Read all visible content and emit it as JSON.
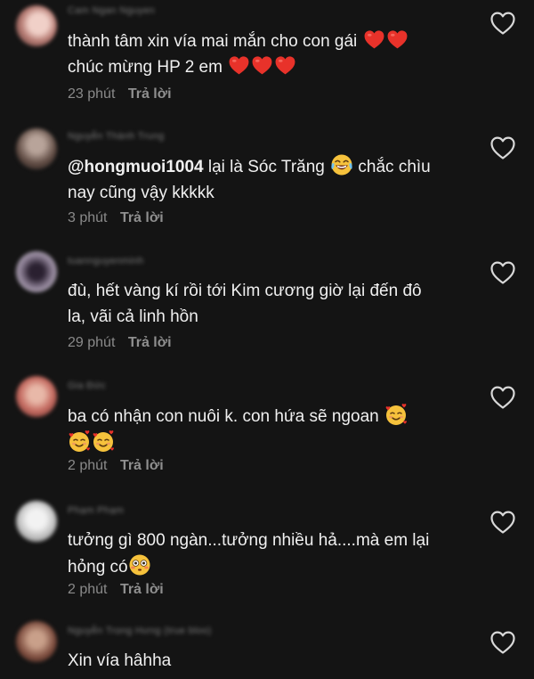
{
  "comments": [
    {
      "username": "Cam Ngan Nguyen",
      "text": "thành tâm xin vía mai mắn cho con gái",
      "text2": "chúc mừng HP 2 em",
      "time": "23 phút",
      "reply": "Trả lời",
      "avatar_color": "#c98f87"
    },
    {
      "username": "Nguyễn Thành Trung",
      "mention": "@hongmuoi1004",
      "text": " lại là Sóc Trăng",
      "text_after": " chắc chìu",
      "text2": "nay cũng vậy kkkkk",
      "time": "3 phút",
      "reply": "Trả lời",
      "avatar_color": "#6a5a52"
    },
    {
      "username": "tuannguyenminh",
      "text": "đù, hết vàng kí rồi tới Kim cương giờ lại đến đô",
      "text2": "la, vãi cả linh hồn",
      "time": "29 phút",
      "reply": "Trả lời",
      "avatar_color": "#b9b2c4"
    },
    {
      "username": "Gia Đức",
      "text": "ba có nhận con nuôi k. con hứa sẽ ngoan",
      "time": "2 phút",
      "reply": "Trả lời",
      "avatar_color": "#c9746a"
    },
    {
      "username": "Phạm Phạm",
      "text": "tưởng gì 800 ngàn...tưởng nhiều hả....mà em lại",
      "text2": "hỏng có",
      "time": "2 phút",
      "reply": "Trả lời",
      "avatar_color": "#cfcfcf"
    },
    {
      "username": "Nguyễn Trọng Hưng (true bloo)",
      "text": "Xin vía hâhha",
      "avatar_color": "#7a4a3c"
    }
  ],
  "icons": {
    "like": "heart-outline-icon",
    "red_heart": "red-heart-emoji",
    "laughing": "tears-of-joy-emoji",
    "hearts_face": "smiling-face-with-hearts-emoji",
    "flushed": "flushed-face-emoji"
  },
  "colors": {
    "background": "#141414",
    "text": "#f0f0f0",
    "meta": "#8a8a8a",
    "emoji_red": "#e8322a",
    "emoji_yellow": "#f6c23c"
  }
}
